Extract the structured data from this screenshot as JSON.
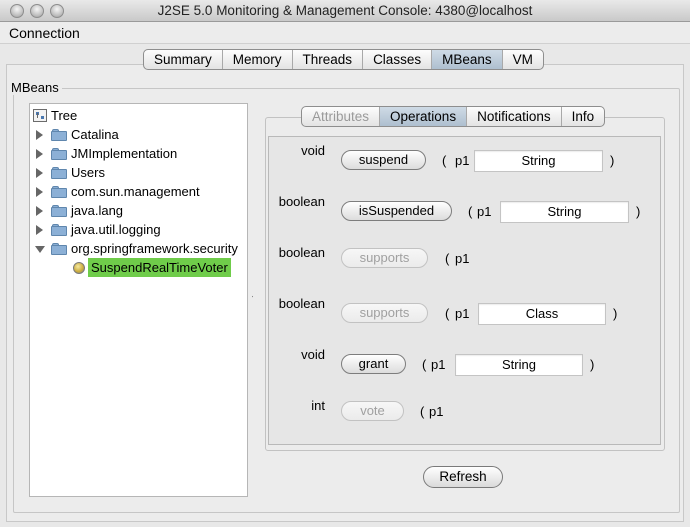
{
  "window": {
    "title": "J2SE 5.0 Monitoring & Management Console: 4380@localhost"
  },
  "menu": {
    "connection": "Connection"
  },
  "top_tabs": [
    "Summary",
    "Memory",
    "Threads",
    "Classes",
    "MBeans",
    "VM"
  ],
  "top_tab_selected": "MBeans",
  "mbeans_label": "MBeans",
  "tree": {
    "root": "Tree",
    "nodes": [
      "Catalina",
      "JMImplementation",
      "Users",
      "com.sun.management",
      "java.lang",
      "java.util.logging",
      "org.springframework.security"
    ],
    "selected_leaf": "SuspendRealTimeVoter"
  },
  "sub_tabs": [
    "Attributes",
    "Operations",
    "Notifications",
    "Info"
  ],
  "sub_tab_selected": "Operations",
  "operations": [
    {
      "return_type": "void",
      "name": "suspend",
      "enabled": true,
      "param_label": "p1",
      "param_type": "String"
    },
    {
      "return_type": "boolean",
      "name": "isSuspended",
      "enabled": true,
      "param_label": "p1",
      "param_type": "String"
    },
    {
      "return_type": "boolean",
      "name": "supports",
      "enabled": false,
      "param_label": "p1",
      "param_type": ""
    },
    {
      "return_type": "boolean",
      "name": "supports",
      "enabled": false,
      "param_label": "p1",
      "param_type": "Class"
    },
    {
      "return_type": "void",
      "name": "grant",
      "enabled": true,
      "param_label": "p1",
      "param_type": "String"
    },
    {
      "return_type": "int",
      "name": "vote",
      "enabled": false,
      "param_label": "p1",
      "param_type": ""
    }
  ],
  "punct": {
    "open": "(",
    "close": ")"
  },
  "refresh_label": "Refresh",
  "colors": {
    "selected_leaf": "#6fcc4a",
    "selected_tab": "#b8c8d8"
  }
}
